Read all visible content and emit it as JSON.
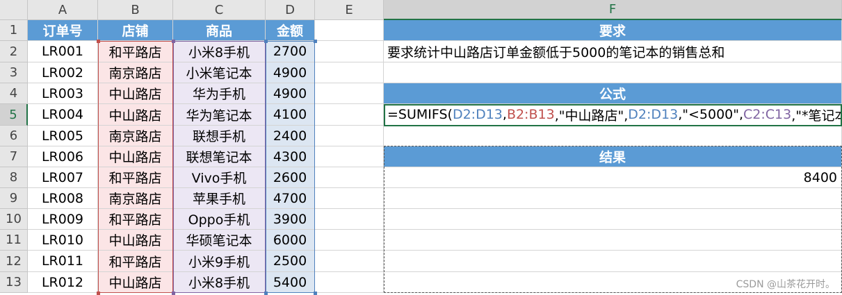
{
  "columns": [
    "A",
    "B",
    "C",
    "D",
    "E",
    "F"
  ],
  "rows": [
    "1",
    "2",
    "3",
    "4",
    "5",
    "6",
    "7",
    "8",
    "9",
    "10",
    "11",
    "12",
    "13"
  ],
  "table_headers": [
    "订单号",
    "店铺",
    "商品",
    "金额"
  ],
  "table_rows": [
    [
      "LR001",
      "和平路店",
      "小米8手机",
      "2700"
    ],
    [
      "LR002",
      "南京路店",
      "小米笔记本",
      "4900"
    ],
    [
      "LR003",
      "中山路店",
      "华为手机",
      "4900"
    ],
    [
      "LR004",
      "中山路店",
      "华为笔记本",
      "4100"
    ],
    [
      "LR005",
      "南京路店",
      "联想手机",
      "2400"
    ],
    [
      "LR006",
      "中山路店",
      "联想笔记本",
      "4300"
    ],
    [
      "LR007",
      "和平路店",
      "Vivo手机",
      "2600"
    ],
    [
      "LR008",
      "南京路店",
      "苹果手机",
      "4700"
    ],
    [
      "LR009",
      "和平路店",
      "Oppo手机",
      "3900"
    ],
    [
      "LR010",
      "中山路店",
      "华硕笔记本",
      "6000"
    ],
    [
      "LR011",
      "和平路店",
      "小米9手机",
      "2500"
    ],
    [
      "LR012",
      "中山路店",
      "小米8手机",
      "5400"
    ]
  ],
  "panel": {
    "requirement_header": "要求",
    "requirement_text": "要求统计中山路店订单金额低于5000的笔记本的销售总和",
    "formula_header": "公式",
    "formula_parts": [
      {
        "text": "=SUMIFS(",
        "color": "k"
      },
      {
        "text": "D2:D13",
        "color": "d"
      },
      {
        "text": ",",
        "color": "k"
      },
      {
        "text": "B2:B13",
        "color": "b"
      },
      {
        "text": ",\"中山路店\",",
        "color": "k"
      },
      {
        "text": "D2:D13",
        "color": "d"
      },
      {
        "text": ",\"<5000\",",
        "color": "k"
      },
      {
        "text": "C2:C13",
        "color": "c"
      },
      {
        "text": ",\"*笔记本\")",
        "color": "k"
      }
    ],
    "result_header": "结果",
    "result_value": "8400"
  },
  "active_cell": {
    "column": "F",
    "row": "5"
  },
  "colors": {
    "header_fill": "#5b9bd5",
    "ref_B": "#c0504d",
    "ref_C": "#8064a2",
    "ref_D": "#4f81bd",
    "selection": "#217346"
  },
  "watermark": "CSDN @山茶花开时。"
}
